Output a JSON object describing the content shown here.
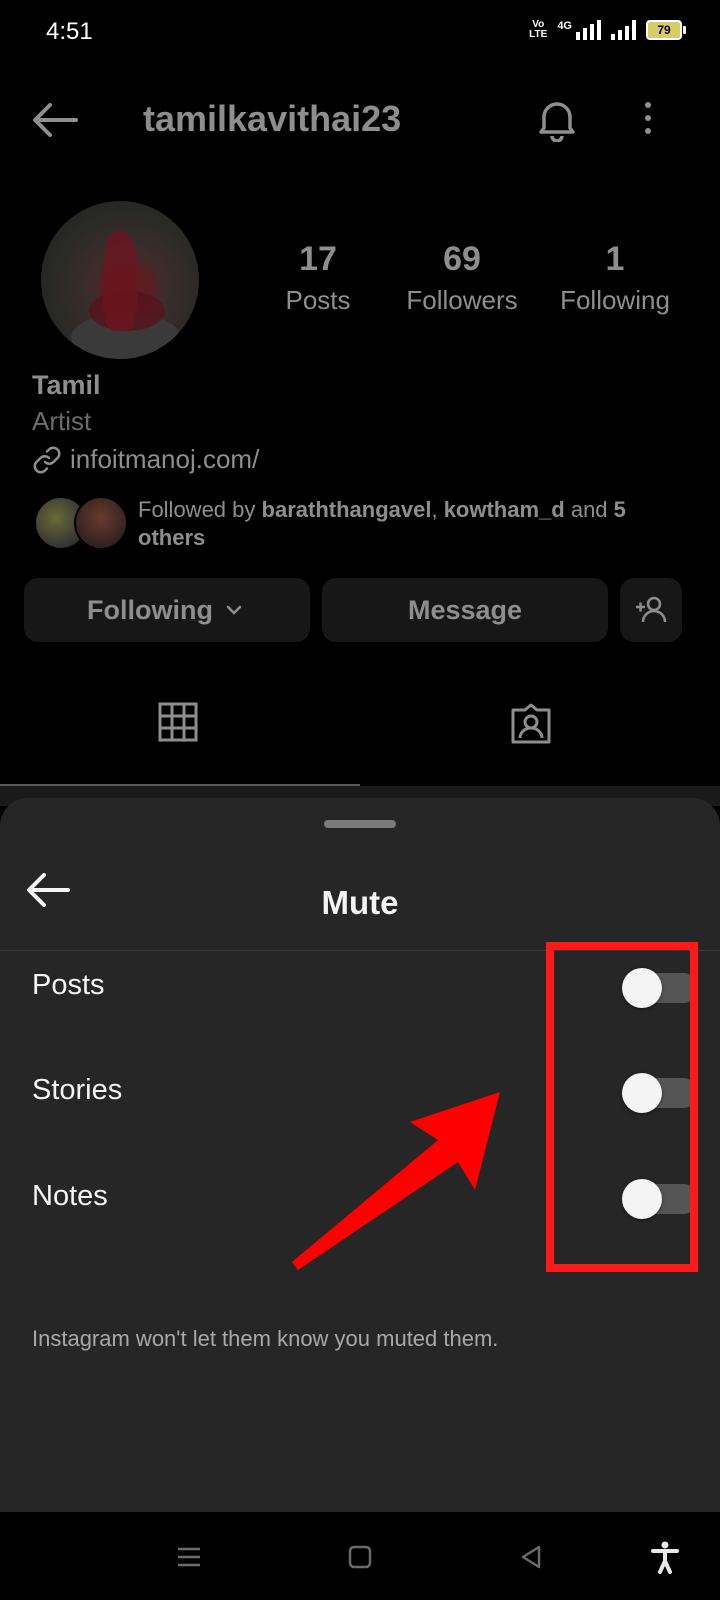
{
  "status_bar": {
    "time": "4:51",
    "volte": "Vo\nLTE",
    "network": "4G",
    "battery": "79"
  },
  "profile": {
    "username": "tamilkavithai23",
    "stats": [
      {
        "value": "17",
        "label": "Posts"
      },
      {
        "value": "69",
        "label": "Followers"
      },
      {
        "value": "1",
        "label": "Following"
      }
    ],
    "name": "Tamil",
    "category": "Artist",
    "link": "infoitmanoj.com/",
    "followed_by": {
      "prefix": "Followed by ",
      "user1": "baraththangavel",
      "sep": ", ",
      "user2": "kowtham_d",
      "and": " and ",
      "others": "5 others"
    },
    "buttons": {
      "following": "Following",
      "message": "Message"
    }
  },
  "sheet": {
    "title": "Mute",
    "options": [
      {
        "label": "Posts",
        "enabled": false
      },
      {
        "label": "Stories",
        "enabled": false
      },
      {
        "label": "Notes",
        "enabled": false
      }
    ],
    "note": "Instagram won't let them know you muted them."
  },
  "colors": {
    "highlight": "#ff1a1a",
    "sheet_bg": "#262626"
  },
  "icons": {
    "back": "back-arrow-icon",
    "bell": "bell-icon",
    "more": "more-vertical-icon",
    "link": "link-icon",
    "add_user": "add-user-icon",
    "grid": "grid-icon",
    "tagged": "tagged-icon"
  }
}
